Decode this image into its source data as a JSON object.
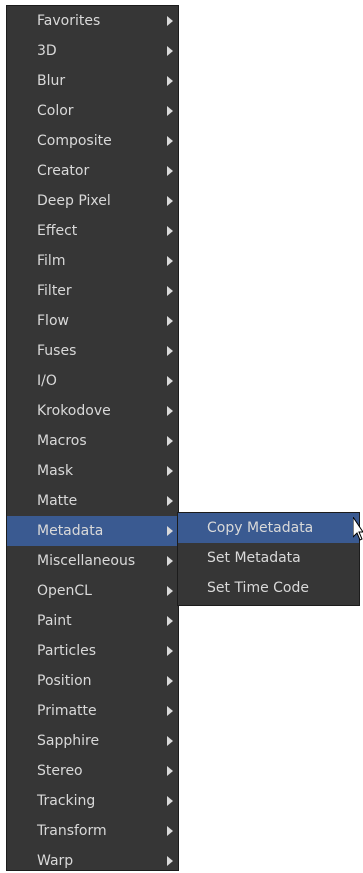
{
  "menu": {
    "items": [
      {
        "label": "Favorites"
      },
      {
        "label": "3D"
      },
      {
        "label": "Blur"
      },
      {
        "label": "Color"
      },
      {
        "label": "Composite"
      },
      {
        "label": "Creator"
      },
      {
        "label": "Deep Pixel"
      },
      {
        "label": "Effect"
      },
      {
        "label": "Film"
      },
      {
        "label": "Filter"
      },
      {
        "label": "Flow"
      },
      {
        "label": "Fuses"
      },
      {
        "label": "I/O"
      },
      {
        "label": "Krokodove"
      },
      {
        "label": "Macros"
      },
      {
        "label": "Mask"
      },
      {
        "label": "Matte"
      },
      {
        "label": "Metadata"
      },
      {
        "label": "Miscellaneous"
      },
      {
        "label": "OpenCL"
      },
      {
        "label": "Paint"
      },
      {
        "label": "Particles"
      },
      {
        "label": "Position"
      },
      {
        "label": "Primatte"
      },
      {
        "label": "Sapphire"
      },
      {
        "label": "Stereo"
      },
      {
        "label": "Tracking"
      },
      {
        "label": "Transform"
      },
      {
        "label": "Warp"
      }
    ],
    "highlighted_item": "Metadata"
  },
  "submenu": {
    "items": [
      {
        "label": "Copy Metadata"
      },
      {
        "label": "Set Metadata"
      },
      {
        "label": "Set Time Code"
      }
    ],
    "highlighted_item": "Copy Metadata"
  },
  "colors": {
    "menu_background": "#363636",
    "highlight": "#3a5a91",
    "text": "#d9d9d9",
    "arrow": "#d9d9d9"
  },
  "icons": {
    "submenu_arrow": "chevron-right-icon",
    "cursor": "mouse-pointer-icon"
  }
}
